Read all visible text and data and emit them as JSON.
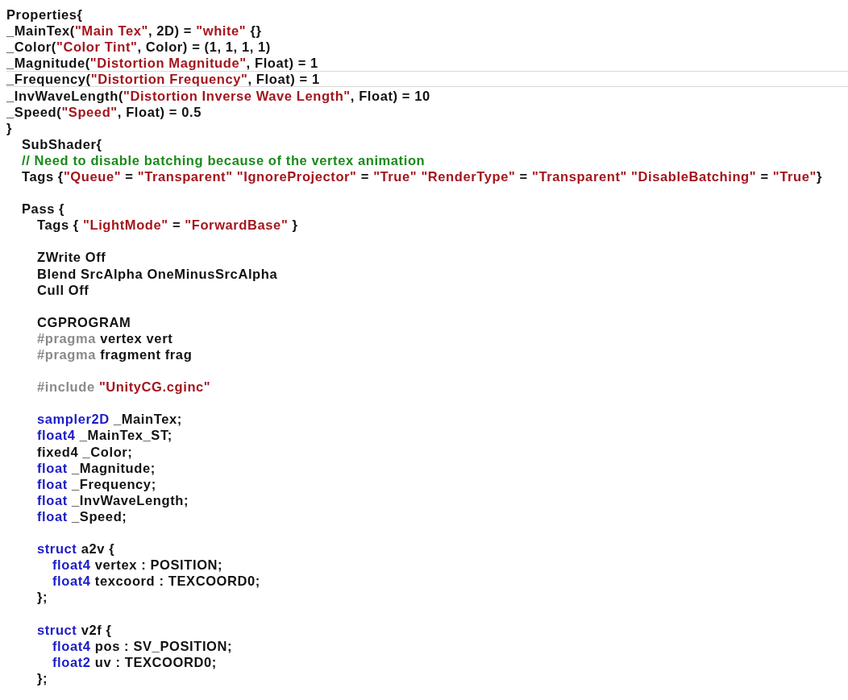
{
  "editor": {
    "lines": [
      {
        "kind": "code",
        "highlighted": false,
        "tokens": [
          {
            "kind": "plain",
            "text": "Properties{"
          }
        ]
      },
      {
        "kind": "code",
        "highlighted": false,
        "tokens": [
          {
            "kind": "plain",
            "text": "_MainTex("
          },
          {
            "kind": "string",
            "text": "\"Main Tex\""
          },
          {
            "kind": "plain",
            "text": ", 2D) = "
          },
          {
            "kind": "string",
            "text": "\"white\""
          },
          {
            "kind": "plain",
            "text": " {}"
          }
        ]
      },
      {
        "kind": "code",
        "highlighted": false,
        "tokens": [
          {
            "kind": "plain",
            "text": "_Color("
          },
          {
            "kind": "string",
            "text": "\"Color Tint\""
          },
          {
            "kind": "plain",
            "text": ", Color) = (1, 1, 1, 1)"
          }
        ]
      },
      {
        "kind": "code",
        "highlighted": false,
        "tokens": [
          {
            "kind": "plain",
            "text": "_Magnitude("
          },
          {
            "kind": "string",
            "text": "\"Distortion Magnitude\""
          },
          {
            "kind": "plain",
            "text": ", Float) = 1"
          }
        ]
      },
      {
        "kind": "code",
        "highlighted": true,
        "tokens": [
          {
            "kind": "plain",
            "text": "_Frequency("
          },
          {
            "kind": "string",
            "text": "\"Distortion Frequency\""
          },
          {
            "kind": "plain",
            "text": ", Float) = 1"
          }
        ]
      },
      {
        "kind": "code",
        "highlighted": false,
        "tokens": [
          {
            "kind": "plain",
            "text": "_InvWaveLength("
          },
          {
            "kind": "string",
            "text": "\"Distortion Inverse Wave Length\""
          },
          {
            "kind": "plain",
            "text": ", Float) = 10"
          }
        ]
      },
      {
        "kind": "code",
        "highlighted": false,
        "tokens": [
          {
            "kind": "plain",
            "text": "_Speed("
          },
          {
            "kind": "string",
            "text": "\"Speed\""
          },
          {
            "kind": "plain",
            "text": ", Float) = 0.5"
          }
        ]
      },
      {
        "kind": "code",
        "highlighted": false,
        "tokens": [
          {
            "kind": "plain",
            "text": "}"
          }
        ],
        "children": [
          {
            "kind": "code",
            "highlighted": false,
            "tokens": [
              {
                "kind": "plain",
                "text": "SubShader{"
              }
            ]
          },
          {
            "kind": "code",
            "highlighted": false,
            "tokens": [
              {
                "kind": "comment",
                "text": "// Need to disable batching because of the vertex animation"
              }
            ]
          },
          {
            "kind": "code",
            "highlighted": false,
            "tokens": [
              {
                "kind": "plain",
                "text": "Tags {"
              },
              {
                "kind": "string",
                "text": "\"Queue\""
              },
              {
                "kind": "plain",
                "text": " = "
              },
              {
                "kind": "string",
                "text": "\"Transparent\""
              },
              {
                "kind": "string",
                "text": " \"IgnoreProjector\""
              },
              {
                "kind": "plain",
                "text": " = "
              },
              {
                "kind": "string",
                "text": "\"True\""
              },
              {
                "kind": "string",
                "text": " \"RenderType\""
              },
              {
                "kind": "plain",
                "text": " = "
              },
              {
                "kind": "string",
                "text": "\"Transparent\""
              },
              {
                "kind": "string",
                "text": " \"DisableBatching\""
              },
              {
                "kind": "plain",
                "text": " = "
              },
              {
                "kind": "string",
                "text": "\"True\""
              },
              {
                "kind": "plain",
                "text": "}"
              }
            ]
          },
          {
            "kind": "blank",
            "highlighted": false
          },
          {
            "kind": "code",
            "highlighted": false,
            "tokens": [
              {
                "kind": "plain",
                "text": "Pass {"
              }
            ],
            "children": [
              {
                "kind": "code",
                "highlighted": false,
                "tokens": [
                  {
                    "kind": "plain",
                    "text": "Tags { "
                  },
                  {
                    "kind": "string",
                    "text": "\"LightMode\""
                  },
                  {
                    "kind": "plain",
                    "text": " = "
                  },
                  {
                    "kind": "string",
                    "text": "\"ForwardBase\""
                  },
                  {
                    "kind": "plain",
                    "text": " }"
                  }
                ]
              },
              {
                "kind": "blank",
                "highlighted": false
              },
              {
                "kind": "code",
                "highlighted": false,
                "tokens": [
                  {
                    "kind": "plain",
                    "text": "ZWrite Off"
                  }
                ]
              },
              {
                "kind": "code",
                "highlighted": false,
                "tokens": [
                  {
                    "kind": "plain",
                    "text": "Blend SrcAlpha OneMinusSrcAlpha"
                  }
                ]
              },
              {
                "kind": "code",
                "highlighted": false,
                "tokens": [
                  {
                    "kind": "plain",
                    "text": "Cull Off"
                  }
                ]
              },
              {
                "kind": "blank",
                "highlighted": false
              },
              {
                "kind": "code",
                "highlighted": false,
                "tokens": [
                  {
                    "kind": "plain",
                    "text": "CGPROGRAM"
                  }
                ]
              },
              {
                "kind": "code",
                "highlighted": false,
                "tokens": [
                  {
                    "kind": "directive",
                    "text": "#pragma"
                  },
                  {
                    "kind": "plain",
                    "text": " vertex vert"
                  }
                ]
              },
              {
                "kind": "code",
                "highlighted": false,
                "tokens": [
                  {
                    "kind": "directive",
                    "text": "#pragma"
                  },
                  {
                    "kind": "plain",
                    "text": " fragment frag"
                  }
                ]
              },
              {
                "kind": "blank",
                "highlighted": false
              },
              {
                "kind": "code",
                "highlighted": false,
                "tokens": [
                  {
                    "kind": "directive",
                    "text": "#include"
                  },
                  {
                    "kind": "string",
                    "text": " \"UnityCG.cginc\""
                  }
                ]
              },
              {
                "kind": "blank",
                "highlighted": false
              },
              {
                "kind": "code",
                "highlighted": false,
                "tokens": [
                  {
                    "kind": "keyword",
                    "text": "sampler2D"
                  },
                  {
                    "kind": "plain",
                    "text": " _MainTex;"
                  }
                ]
              },
              {
                "kind": "code",
                "highlighted": false,
                "tokens": [
                  {
                    "kind": "keyword",
                    "text": "float4"
                  },
                  {
                    "kind": "plain",
                    "text": " _MainTex_ST;"
                  }
                ]
              },
              {
                "kind": "code",
                "highlighted": false,
                "tokens": [
                  {
                    "kind": "plain",
                    "text": "fixed4 _Color;"
                  }
                ]
              },
              {
                "kind": "code",
                "highlighted": false,
                "tokens": [
                  {
                    "kind": "keyword",
                    "text": "float"
                  },
                  {
                    "kind": "plain",
                    "text": " _Magnitude;"
                  }
                ]
              },
              {
                "kind": "code",
                "highlighted": false,
                "tokens": [
                  {
                    "kind": "keyword",
                    "text": "float"
                  },
                  {
                    "kind": "plain",
                    "text": " _Frequency;"
                  }
                ]
              },
              {
                "kind": "code",
                "highlighted": false,
                "tokens": [
                  {
                    "kind": "keyword",
                    "text": "float"
                  },
                  {
                    "kind": "plain",
                    "text": " _InvWaveLength;"
                  }
                ]
              },
              {
                "kind": "code",
                "highlighted": false,
                "tokens": [
                  {
                    "kind": "keyword",
                    "text": "float"
                  },
                  {
                    "kind": "plain",
                    "text": " _Speed;"
                  }
                ]
              },
              {
                "kind": "blank",
                "highlighted": false
              },
              {
                "kind": "code",
                "highlighted": false,
                "tokens": [
                  {
                    "kind": "keyword",
                    "text": "struct"
                  },
                  {
                    "kind": "plain",
                    "text": " a2v {"
                  }
                ],
                "children": [
                  {
                    "kind": "code",
                    "highlighted": false,
                    "tokens": [
                      {
                        "kind": "keyword",
                        "text": "float4"
                      },
                      {
                        "kind": "plain",
                        "text": " vertex : POSITION;"
                      }
                    ]
                  },
                  {
                    "kind": "code",
                    "highlighted": false,
                    "tokens": [
                      {
                        "kind": "keyword",
                        "text": "float4"
                      },
                      {
                        "kind": "plain",
                        "text": " texcoord : TEXCOORD0;"
                      }
                    ]
                  }
                ]
              },
              {
                "kind": "code",
                "highlighted": false,
                "tokens": [
                  {
                    "kind": "plain",
                    "text": "};"
                  }
                ]
              },
              {
                "kind": "blank",
                "highlighted": false
              },
              {
                "kind": "code",
                "highlighted": false,
                "tokens": [
                  {
                    "kind": "keyword",
                    "text": "struct"
                  },
                  {
                    "kind": "plain",
                    "text": " v2f {"
                  }
                ],
                "children": [
                  {
                    "kind": "code",
                    "highlighted": false,
                    "tokens": [
                      {
                        "kind": "keyword",
                        "text": "float4"
                      },
                      {
                        "kind": "plain",
                        "text": " pos : SV_POSITION;"
                      }
                    ]
                  },
                  {
                    "kind": "code",
                    "highlighted": false,
                    "tokens": [
                      {
                        "kind": "keyword",
                        "text": "float2"
                      },
                      {
                        "kind": "plain",
                        "text": " uv : TEXCOORD0;"
                      }
                    ]
                  }
                ]
              },
              {
                "kind": "code",
                "highlighted": false,
                "tokens": [
                  {
                    "kind": "plain",
                    "text": "};"
                  }
                ]
              }
            ]
          }
        ]
      }
    ]
  }
}
